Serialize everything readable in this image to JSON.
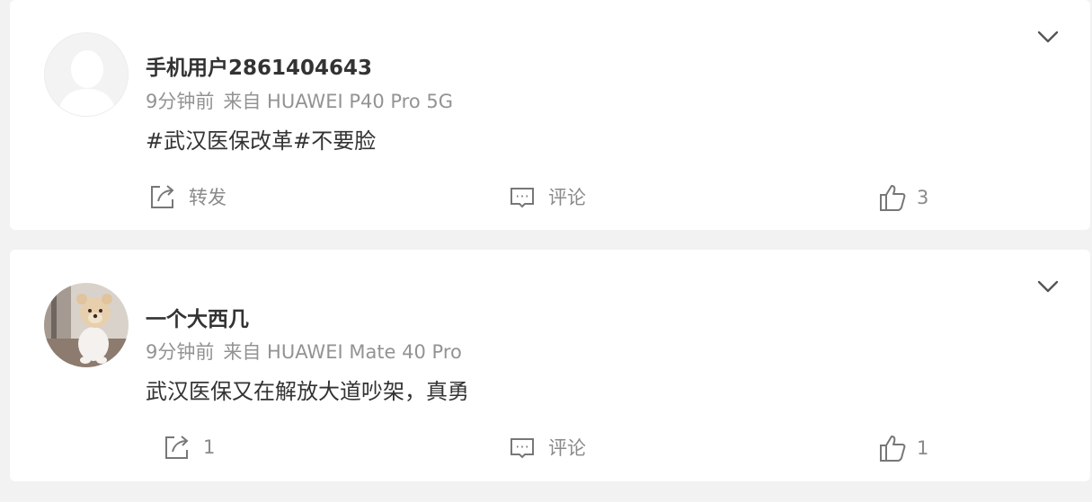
{
  "posts": [
    {
      "username": "手机用户2861404643",
      "time": "9分钟前",
      "source": "来自 HUAWEI P40 Pro 5G",
      "text": "#武汉医保改革#不要脸",
      "share_label": "转发",
      "comment_label": "评论",
      "like_count": "3",
      "avatar": "default-avatar-icon"
    },
    {
      "username": "一个大西几",
      "time": "9分钟前",
      "source": "来自 HUAWEI Mate 40 Pro",
      "text": "武汉医保又在解放大道吵架，真勇",
      "share_label": "1",
      "comment_label": "评论",
      "like_count": "1",
      "avatar": "teddy-bear-photo"
    }
  ],
  "colors": {
    "page_bg": "#f2f2f2",
    "card_bg": "#ffffff",
    "username": "#333333",
    "meta": "#939393",
    "action": "#8a8a8a"
  }
}
